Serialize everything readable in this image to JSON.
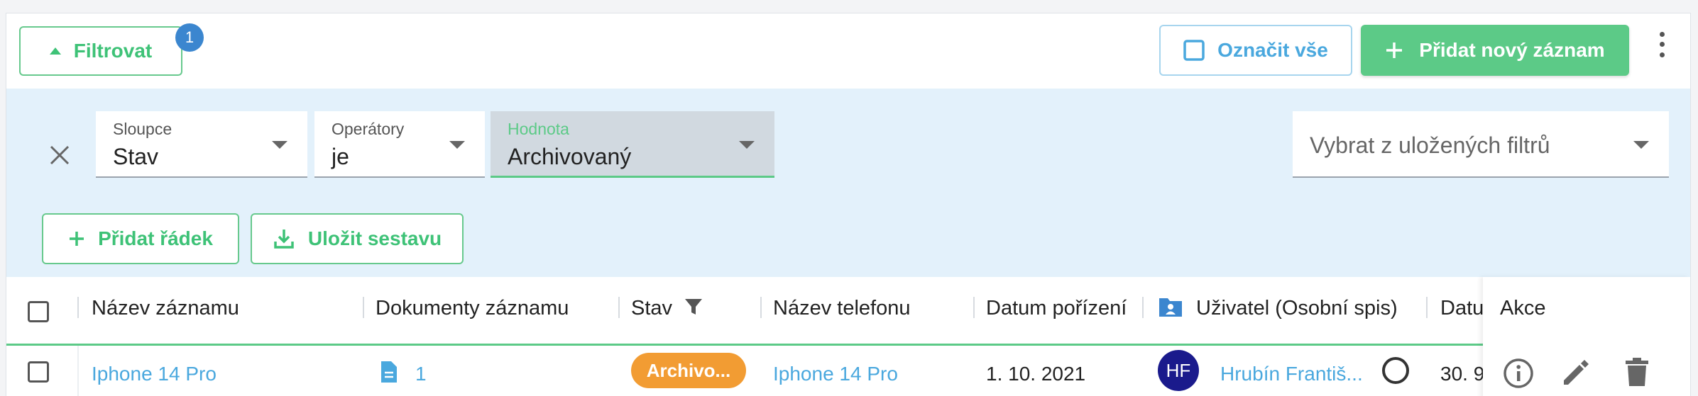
{
  "toolbar": {
    "filter_label": "Filtrovat",
    "filter_badge": "1",
    "select_all_label": "Označit vše",
    "add_record_label": "Přidat nový záznam"
  },
  "filter": {
    "column_label": "Sloupce",
    "column_value": "Stav",
    "operator_label": "Operátory",
    "operator_value": "je",
    "value_label": "Hodnota",
    "value_value": "Archivovaný",
    "saved_placeholder": "Vybrat z uložených filtrů",
    "add_row_label": "Přidat řádek",
    "save_report_label": "Uložit sestavu"
  },
  "table": {
    "headers": {
      "name": "Název záznamu",
      "documents": "Dokumenty záznamu",
      "status": "Stav",
      "phone": "Název telefonu",
      "purchase_date": "Datum pořízení",
      "user": "Uživatel (Osobní spis)",
      "date_cut": "Datu",
      "actions": "Akce"
    },
    "rows": [
      {
        "name": "Iphone 14 Pro",
        "documents": "1",
        "status": "Archivo...",
        "phone": "Iphone 14 Pro",
        "purchase_date": "1. 10. 2021",
        "user_initials": "HF",
        "user_name": "Hrubín Františ...",
        "date_cut": "30. 9"
      }
    ]
  },
  "colors": {
    "accent_green": "#5cca87",
    "link_blue": "#4aa8de",
    "status_orange": "#f29c33",
    "avatar_navy": "#1a1a8c",
    "filter_bg": "#e3f1fb"
  }
}
